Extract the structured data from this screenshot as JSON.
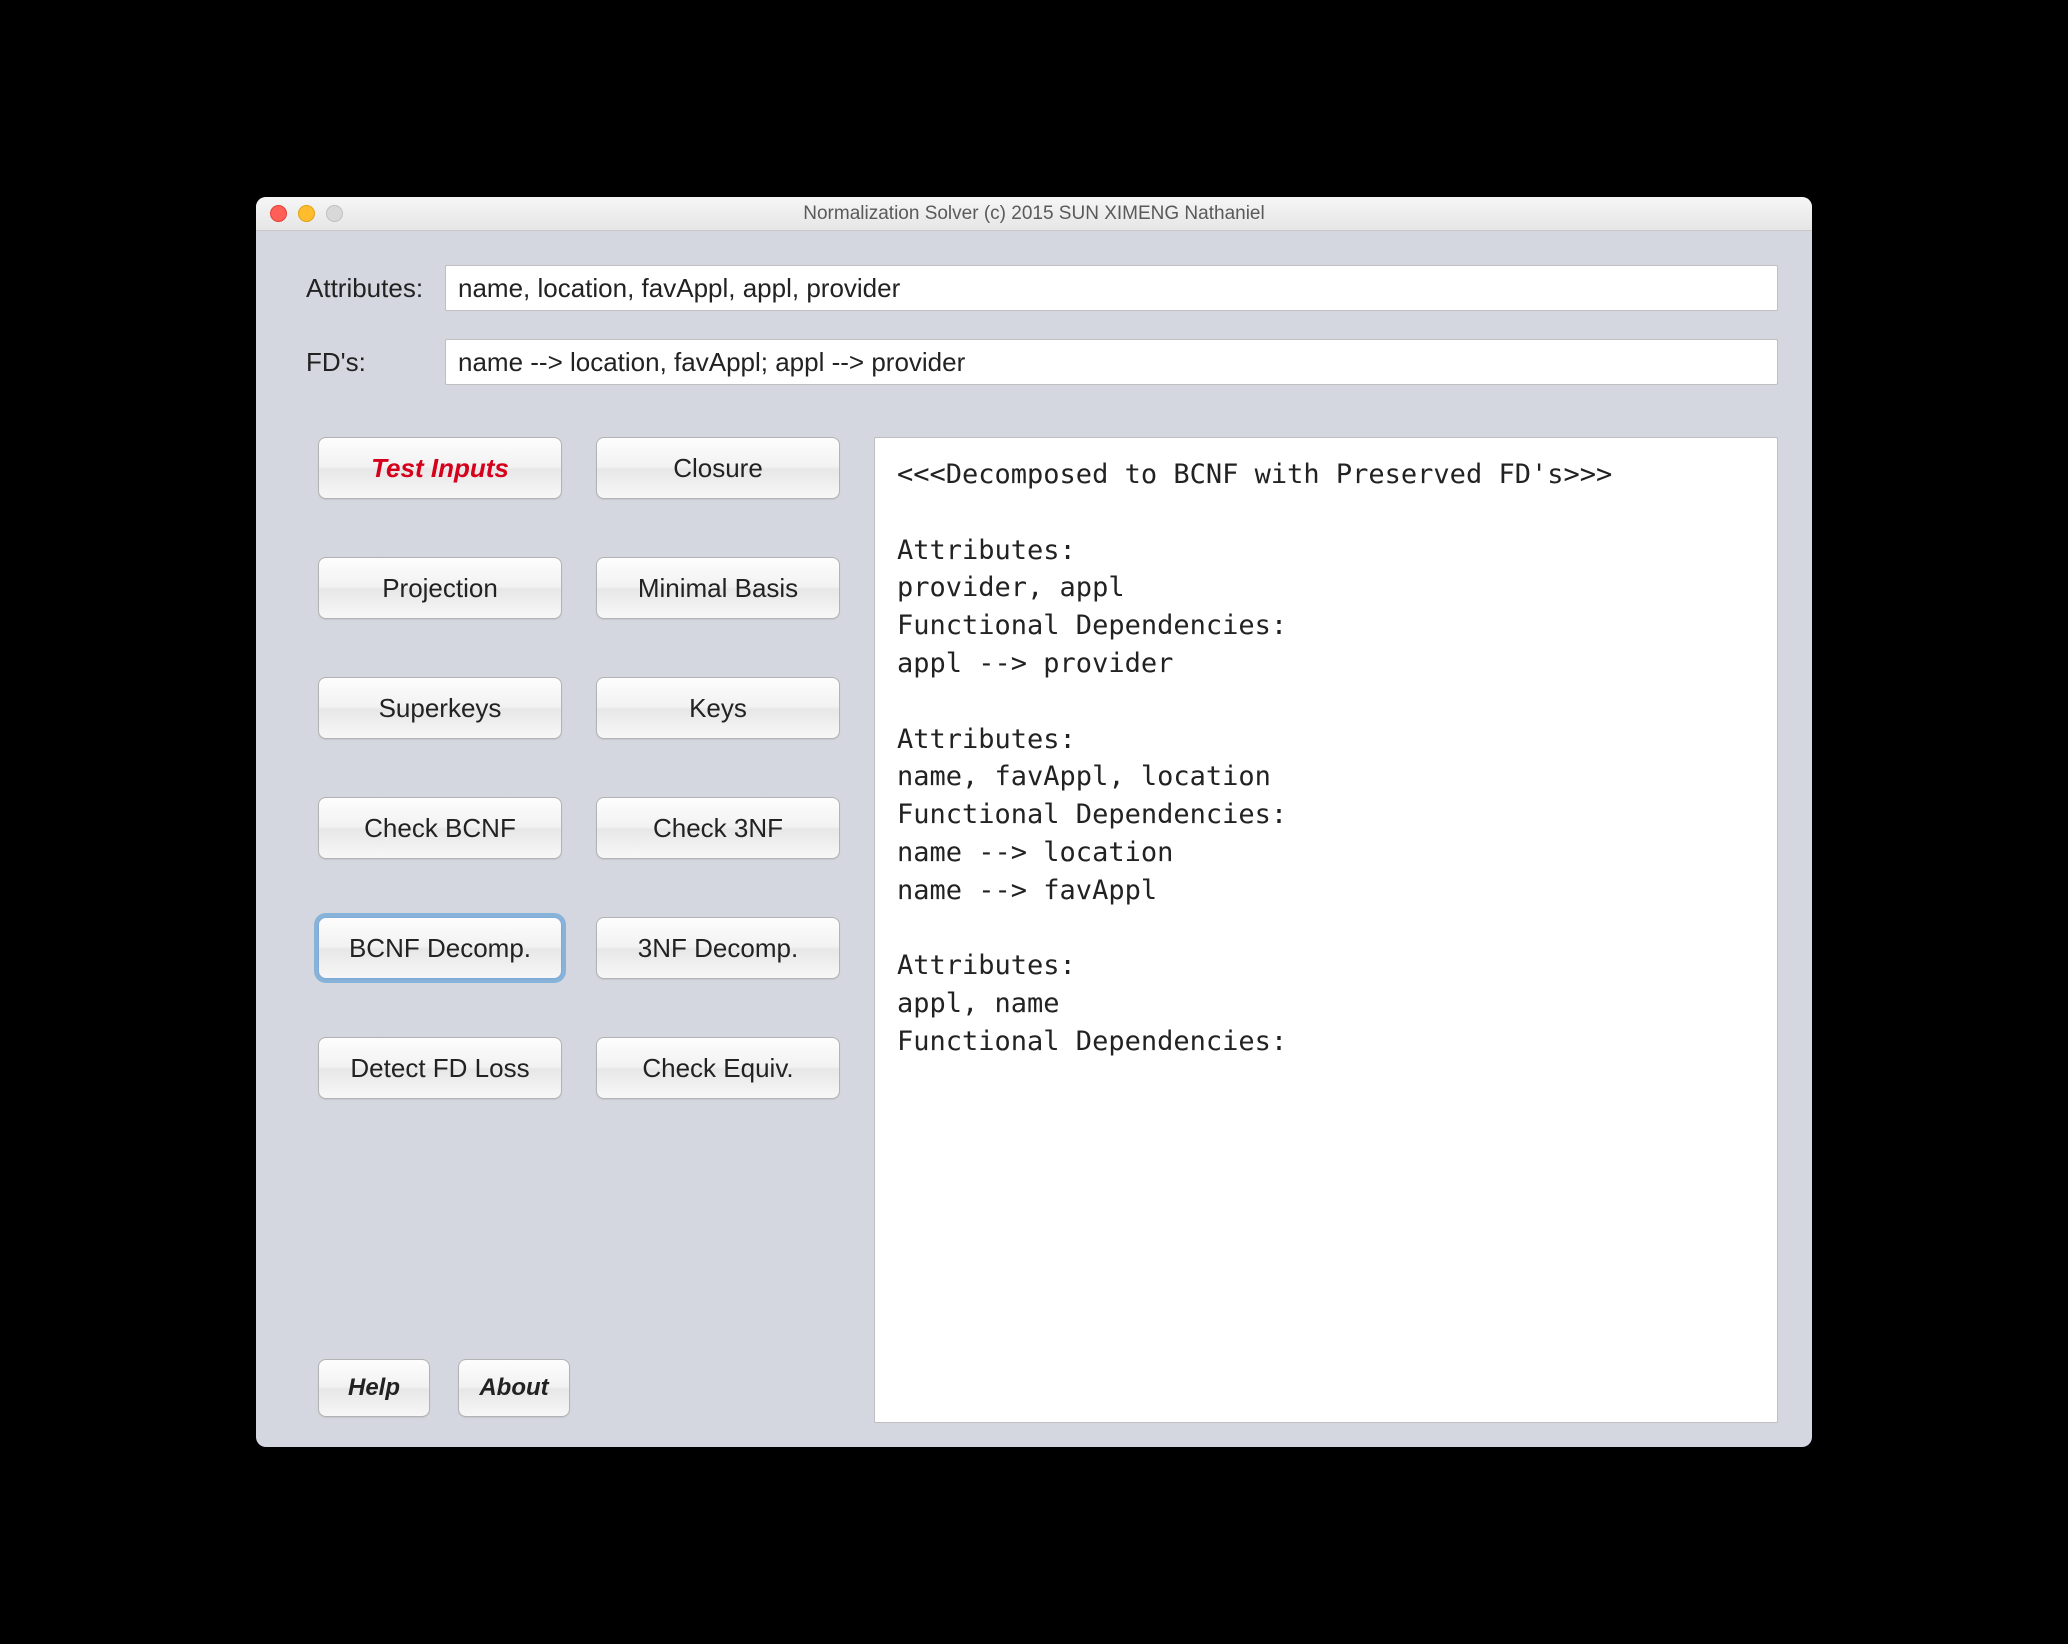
{
  "window": {
    "title": "Normalization Solver (c) 2015 SUN XIMENG Nathaniel"
  },
  "inputs": {
    "attributes": {
      "label": "Attributes:",
      "value": "name, location, favAppl, appl, provider"
    },
    "fds": {
      "label": "FD's:",
      "value": "name --> location, favAppl; appl --> provider"
    }
  },
  "buttons": {
    "test_inputs": "Test Inputs",
    "closure": "Closure",
    "projection": "Projection",
    "minimal_basis": "Minimal Basis",
    "superkeys": "Superkeys",
    "keys": "Keys",
    "check_bcnf": "Check BCNF",
    "check_3nf": "Check 3NF",
    "bcnf_decomp": "BCNF Decomp.",
    "nf3_decomp": "3NF Decomp.",
    "detect_fd_loss": "Detect FD Loss",
    "check_equiv": "Check Equiv.",
    "help": "Help",
    "about": "About"
  },
  "output": "<<<Decomposed to BCNF with Preserved FD's>>>\n\nAttributes:\nprovider, appl\nFunctional Dependencies:\nappl --> provider\n\nAttributes:\nname, favAppl, location\nFunctional Dependencies:\nname --> location\nname --> favAppl\n\nAttributes:\nappl, name\nFunctional Dependencies:\n"
}
